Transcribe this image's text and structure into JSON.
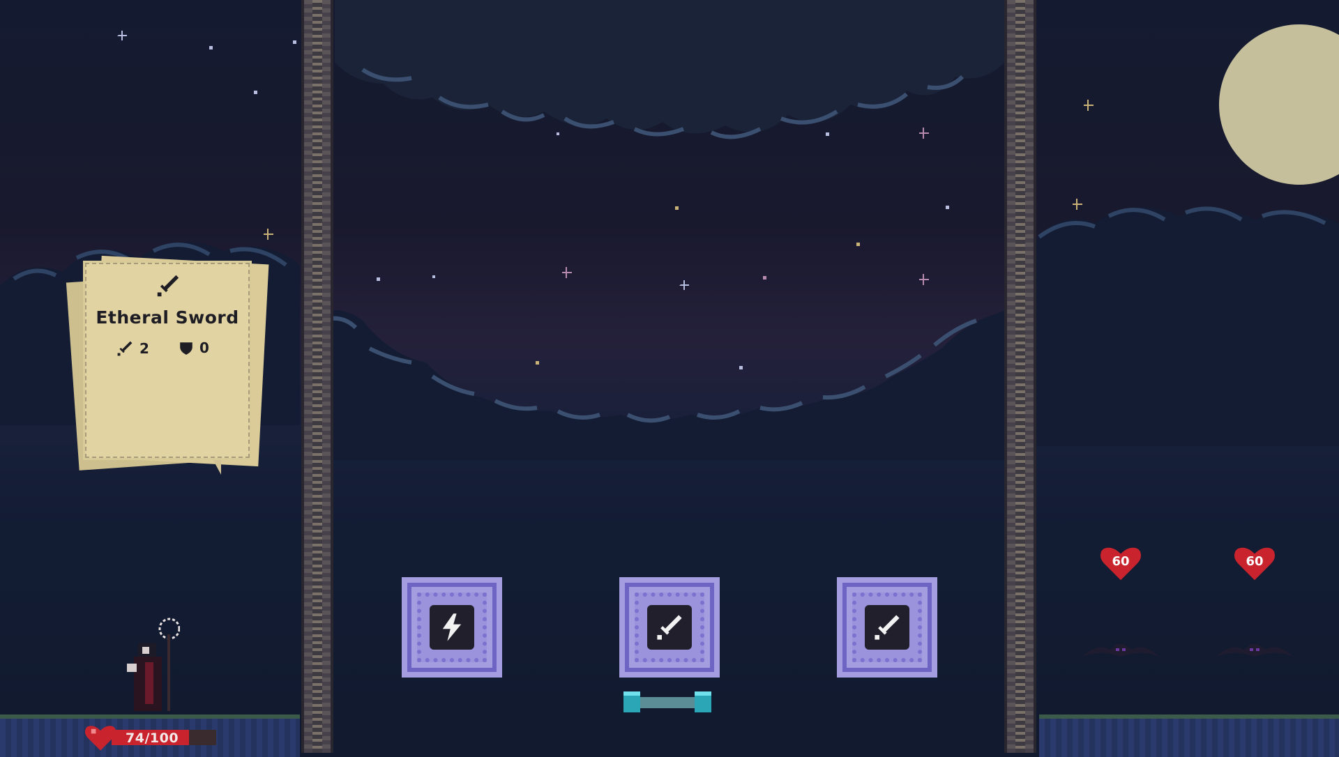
{
  "item_card": {
    "title": "Etheral Sword",
    "icon": "sword-icon",
    "attack_value": "2",
    "defense_value": "0"
  },
  "chests": [
    {
      "icon": "lightning-icon"
    },
    {
      "icon": "sword-icon"
    },
    {
      "icon": "sword-icon"
    }
  ],
  "player": {
    "hp_text": "74/100",
    "hp_fraction": 0.74
  },
  "enemies": [
    {
      "hp": "60"
    },
    {
      "hp": "60"
    }
  ],
  "colors": {
    "card_paper": "#e1d3a2",
    "chest_purple": "#a49de0",
    "health_red": "#c9242d",
    "moon": "#c5bf9c"
  }
}
